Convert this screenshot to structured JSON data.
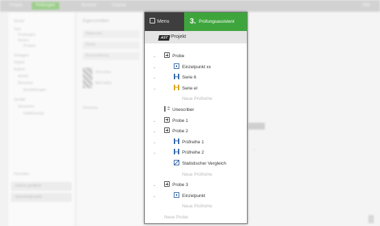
{
  "background": {
    "topbar_tabs": [
      "Projekt",
      "Prüfungen",
      "Berichte",
      "Statistik"
    ],
    "topbar_right": "Hilfe",
    "left_tree": [
      {
        "label": "Suche",
        "indent": 0
      },
      {
        "label": "Test",
        "indent": 0
      },
      {
        "label": "Prüfungen",
        "indent": 1
      },
      {
        "label": "Serien",
        "indent": 1
      },
      {
        "label": "Proben",
        "indent": 2
      },
      {
        "label": "Vorlagen",
        "indent": 0
      },
      {
        "label": "Import",
        "indent": 0
      },
      {
        "label": "Export",
        "indent": 0
      },
      {
        "label": "Archiv",
        "indent": 1
      },
      {
        "label": "Benutzer",
        "indent": 1
      },
      {
        "label": "Einstellungen",
        "indent": 2
      },
      {
        "label": "Geräte",
        "indent": 0
      },
      {
        "label": "Sensoren",
        "indent": 1
      },
      {
        "label": "Kalibrierung",
        "indent": 2
      }
    ],
    "left_section": "Favoriten",
    "left_footer": [
      "Zuletzt geöffnet",
      "Standardprojekt"
    ],
    "mid_header": "Eigenschaften",
    "mid_fields": [
      "Allgemein",
      "Name",
      "Beschreibung"
    ],
    "mid_labels": [
      "Vorschau",
      "Bild laden"
    ],
    "mid_note": "Hinweise"
  },
  "menu": {
    "menu_label": "Menu",
    "wizard_number": "3.",
    "wizard_label": "Prüfungsassistent",
    "project_logo": "AST",
    "project_label": "Projekt",
    "tree": [
      {
        "label": "Probe",
        "icon": "probe-icon",
        "level": 0,
        "caret": true
      },
      {
        "label": "Einzelpunkt xx",
        "icon": "single-point-icon",
        "level": 1,
        "caret": true
      },
      {
        "label": "Serie 6",
        "icon": "series-icon",
        "level": 1,
        "caret": true
      },
      {
        "label": "Serie el",
        "icon": "series-yellow-icon",
        "level": 1,
        "caret": true
      },
      {
        "label": "Neue Prüfreihe",
        "icon": "",
        "level": 2,
        "new": true
      },
      {
        "label": "Unescriber",
        "icon": "unesc-icon",
        "level": 0,
        "caret": false
      },
      {
        "label": "Probe 1",
        "icon": "probe-icon",
        "level": 0,
        "caret": true
      },
      {
        "label": "Probe 2",
        "icon": "probe-icon",
        "level": 0,
        "caret": true
      },
      {
        "label": "Prüfreihe 1",
        "icon": "series-icon",
        "level": 1,
        "caret": true
      },
      {
        "label": "Prüfreihe 2",
        "icon": "series-icon",
        "level": 1,
        "caret": true
      },
      {
        "label": "Statistischer Vergleich",
        "icon": "statistic-icon",
        "level": 1,
        "caret": false
      },
      {
        "label": "Neue Prüfreihe",
        "icon": "",
        "level": 2,
        "new": true
      },
      {
        "label": "Probe 3",
        "icon": "probe-icon",
        "level": 0,
        "caret": true
      },
      {
        "label": "Einzelpunkt",
        "icon": "single-point-icon",
        "level": 1,
        "caret": true
      },
      {
        "label": "Neue Prüfreihe",
        "icon": "",
        "level": 2,
        "new": true
      },
      {
        "label": "Neue Probe",
        "icon": "",
        "level": 0,
        "new": true
      }
    ]
  }
}
